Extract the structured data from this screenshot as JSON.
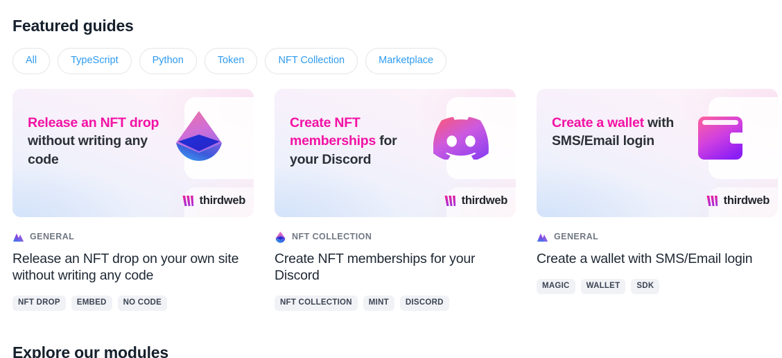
{
  "section": {
    "title": "Featured guides"
  },
  "filters": [
    {
      "label": "All",
      "icon": "filter-pill"
    },
    {
      "label": "TypeScript",
      "icon": "filter-pill"
    },
    {
      "label": "Python",
      "icon": "filter-pill"
    },
    {
      "label": "Token",
      "icon": "filter-pill"
    },
    {
      "label": "NFT Collection",
      "icon": "filter-pill"
    },
    {
      "label": "Marketplace",
      "icon": "filter-pill"
    }
  ],
  "cards": [
    {
      "banner": {
        "highlight": "Release an NFT drop",
        "rest": " without writing any code",
        "art_icon": "thirdweb-drop-icon",
        "brand": "thirdweb",
        "brand_icon": "thirdweb-mark-icon"
      },
      "category": "GENERAL",
      "category_icon": "mountains-icon",
      "title": "Release an NFT drop on your own site without writing any code",
      "tags": [
        "NFT DROP",
        "EMBED",
        "NO CODE"
      ]
    },
    {
      "banner": {
        "highlight": "Create NFT memberships",
        "rest": " for your Discord",
        "art_icon": "discord-icon",
        "brand": "thirdweb",
        "brand_icon": "thirdweb-mark-icon"
      },
      "category": "NFT COLLECTION",
      "category_icon": "drop-icon",
      "title": "Create NFT memberships for your Discord",
      "tags": [
        "NFT COLLECTION",
        "MINT",
        "DISCORD"
      ]
    },
    {
      "banner": {
        "highlight": "Create a wallet",
        "rest": " with SMS/Email login",
        "art_icon": "wallet-icon",
        "brand": "thirdweb",
        "brand_icon": "thirdweb-mark-icon"
      },
      "category": "GENERAL",
      "category_icon": "mountains-icon",
      "title": "Create a wallet with SMS/Email login",
      "tags": [
        "MAGIC",
        "WALLET",
        "SDK"
      ]
    }
  ],
  "next_section": {
    "title": "Explore our modules"
  },
  "colors": {
    "accent_pink": "#f312a4",
    "link_blue": "#2e9bf0",
    "heading": "#16202c",
    "tag_bg": "#f1f2f6",
    "muted": "#707883"
  }
}
